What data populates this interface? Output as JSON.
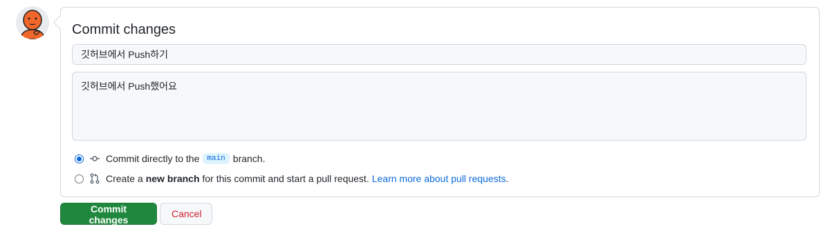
{
  "avatar": {
    "icon": "user-avatar-illustration"
  },
  "form": {
    "title": "Commit changes",
    "summary_value": "깃허브에서 Push하기",
    "description_value": "깃허브에서 Push했어요",
    "option_direct": {
      "prefix": "Commit directly to the",
      "branch": "main",
      "suffix": "branch.",
      "selected": true
    },
    "option_new_branch": {
      "prefix": "Create a",
      "bold": "new branch",
      "suffix": "for this commit and start a pull request.",
      "link": "Learn more about pull requests",
      "link_suffix": ".",
      "selected": false
    }
  },
  "actions": {
    "commit_label": "Commit changes",
    "cancel_label": "Cancel"
  },
  "colors": {
    "accent": "#0969da",
    "primary_button": "#1f883d",
    "danger_text": "#cf222e"
  }
}
